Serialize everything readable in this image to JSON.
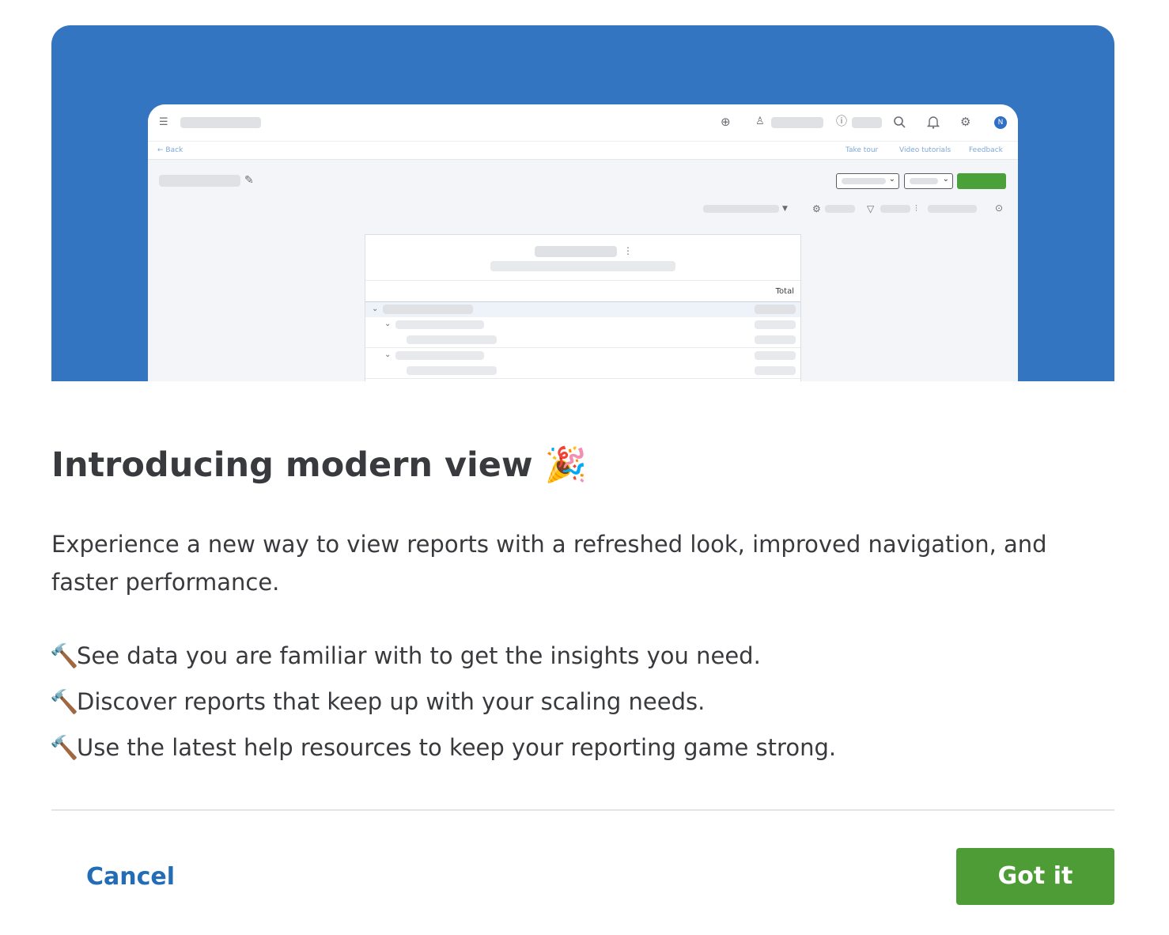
{
  "hero": {
    "column_total": "Total",
    "back_link": "← Back",
    "take_tour": "Take tour",
    "video_tutorials": "Video tutorials",
    "feedback": "Feedback",
    "avatar_initial": "N"
  },
  "dialog": {
    "title": "Introducing modern view",
    "title_emoji": "🎉",
    "description": "Experience a new way to view reports with a refreshed look, improved navigation, and faster performance.",
    "bullets": [
      {
        "icon": "🔨",
        "text": "See data you are familiar with to get the insights you need."
      },
      {
        "icon": "🔨",
        "text": "Discover reports that keep up with your scaling needs."
      },
      {
        "icon": "🔨",
        "text": "Use the latest help resources to keep your reporting game strong."
      }
    ],
    "cancel_label": "Cancel",
    "confirm_label": "Got it"
  },
  "colors": {
    "hero_bg": "#3375c0",
    "primary_button": "#4e9c36",
    "link": "#236cb6"
  }
}
